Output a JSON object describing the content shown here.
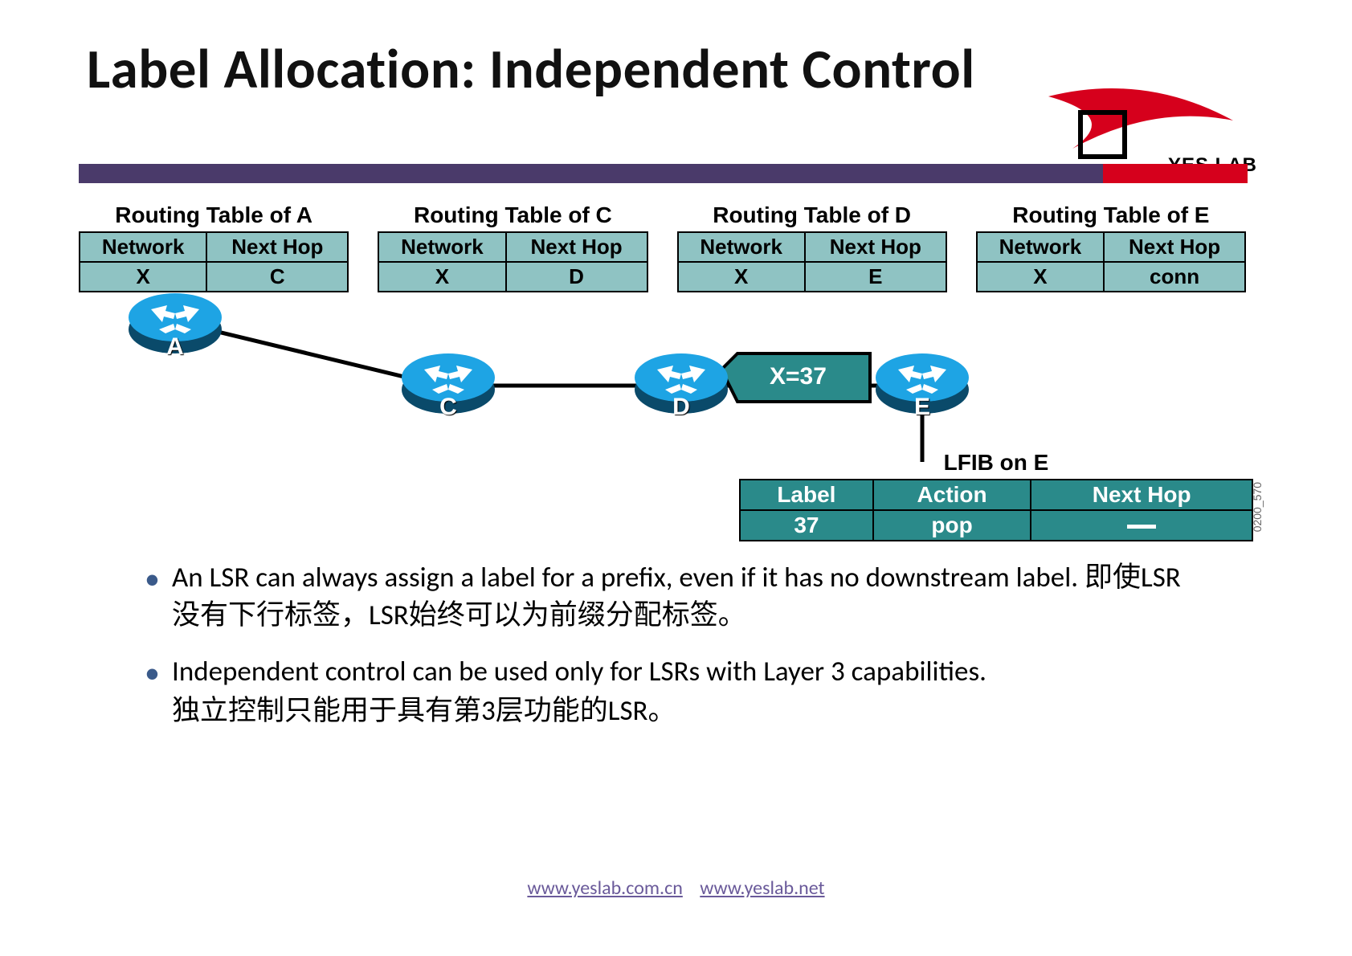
{
  "title": "Label Allocation: Independent Control",
  "logo_text": "YES LAB",
  "routing_tables": [
    {
      "caption": "Routing Table of A",
      "headers": [
        "Network",
        "Next Hop"
      ],
      "row": [
        "X",
        "C"
      ]
    },
    {
      "caption": "Routing Table of C",
      "headers": [
        "Network",
        "Next Hop"
      ],
      "row": [
        "X",
        "D"
      ]
    },
    {
      "caption": "Routing Table of D",
      "headers": [
        "Network",
        "Next Hop"
      ],
      "row": [
        "X",
        "E"
      ]
    },
    {
      "caption": "Routing Table of E",
      "headers": [
        "Network",
        "Next Hop"
      ],
      "row": [
        "X",
        "conn"
      ]
    }
  ],
  "routers": {
    "a": "A",
    "c": "C",
    "d": "D",
    "e": "E"
  },
  "label_arrow": "X=37",
  "lfib": {
    "caption": "LFIB on E",
    "headers": [
      "Label",
      "Action",
      "Next Hop"
    ],
    "row": [
      "37",
      "pop",
      "—"
    ]
  },
  "side_code": "0200_570",
  "bullets": {
    "b1_en": "An LSR can always assign a label for a prefix, even if it has no downstream label.  ",
    "b1_cn": "即使LSR没有下行标签，LSR始终可以为前缀分配标签。",
    "b2_en": "Independent control can be used only for LSRs with Layer 3 capabilities.",
    "b2_cn": "独立控制只能用于具有第3层功能的LSR。"
  },
  "footer": {
    "link1": "www.yeslab.com.cn",
    "link2": "www.yeslab.net"
  }
}
